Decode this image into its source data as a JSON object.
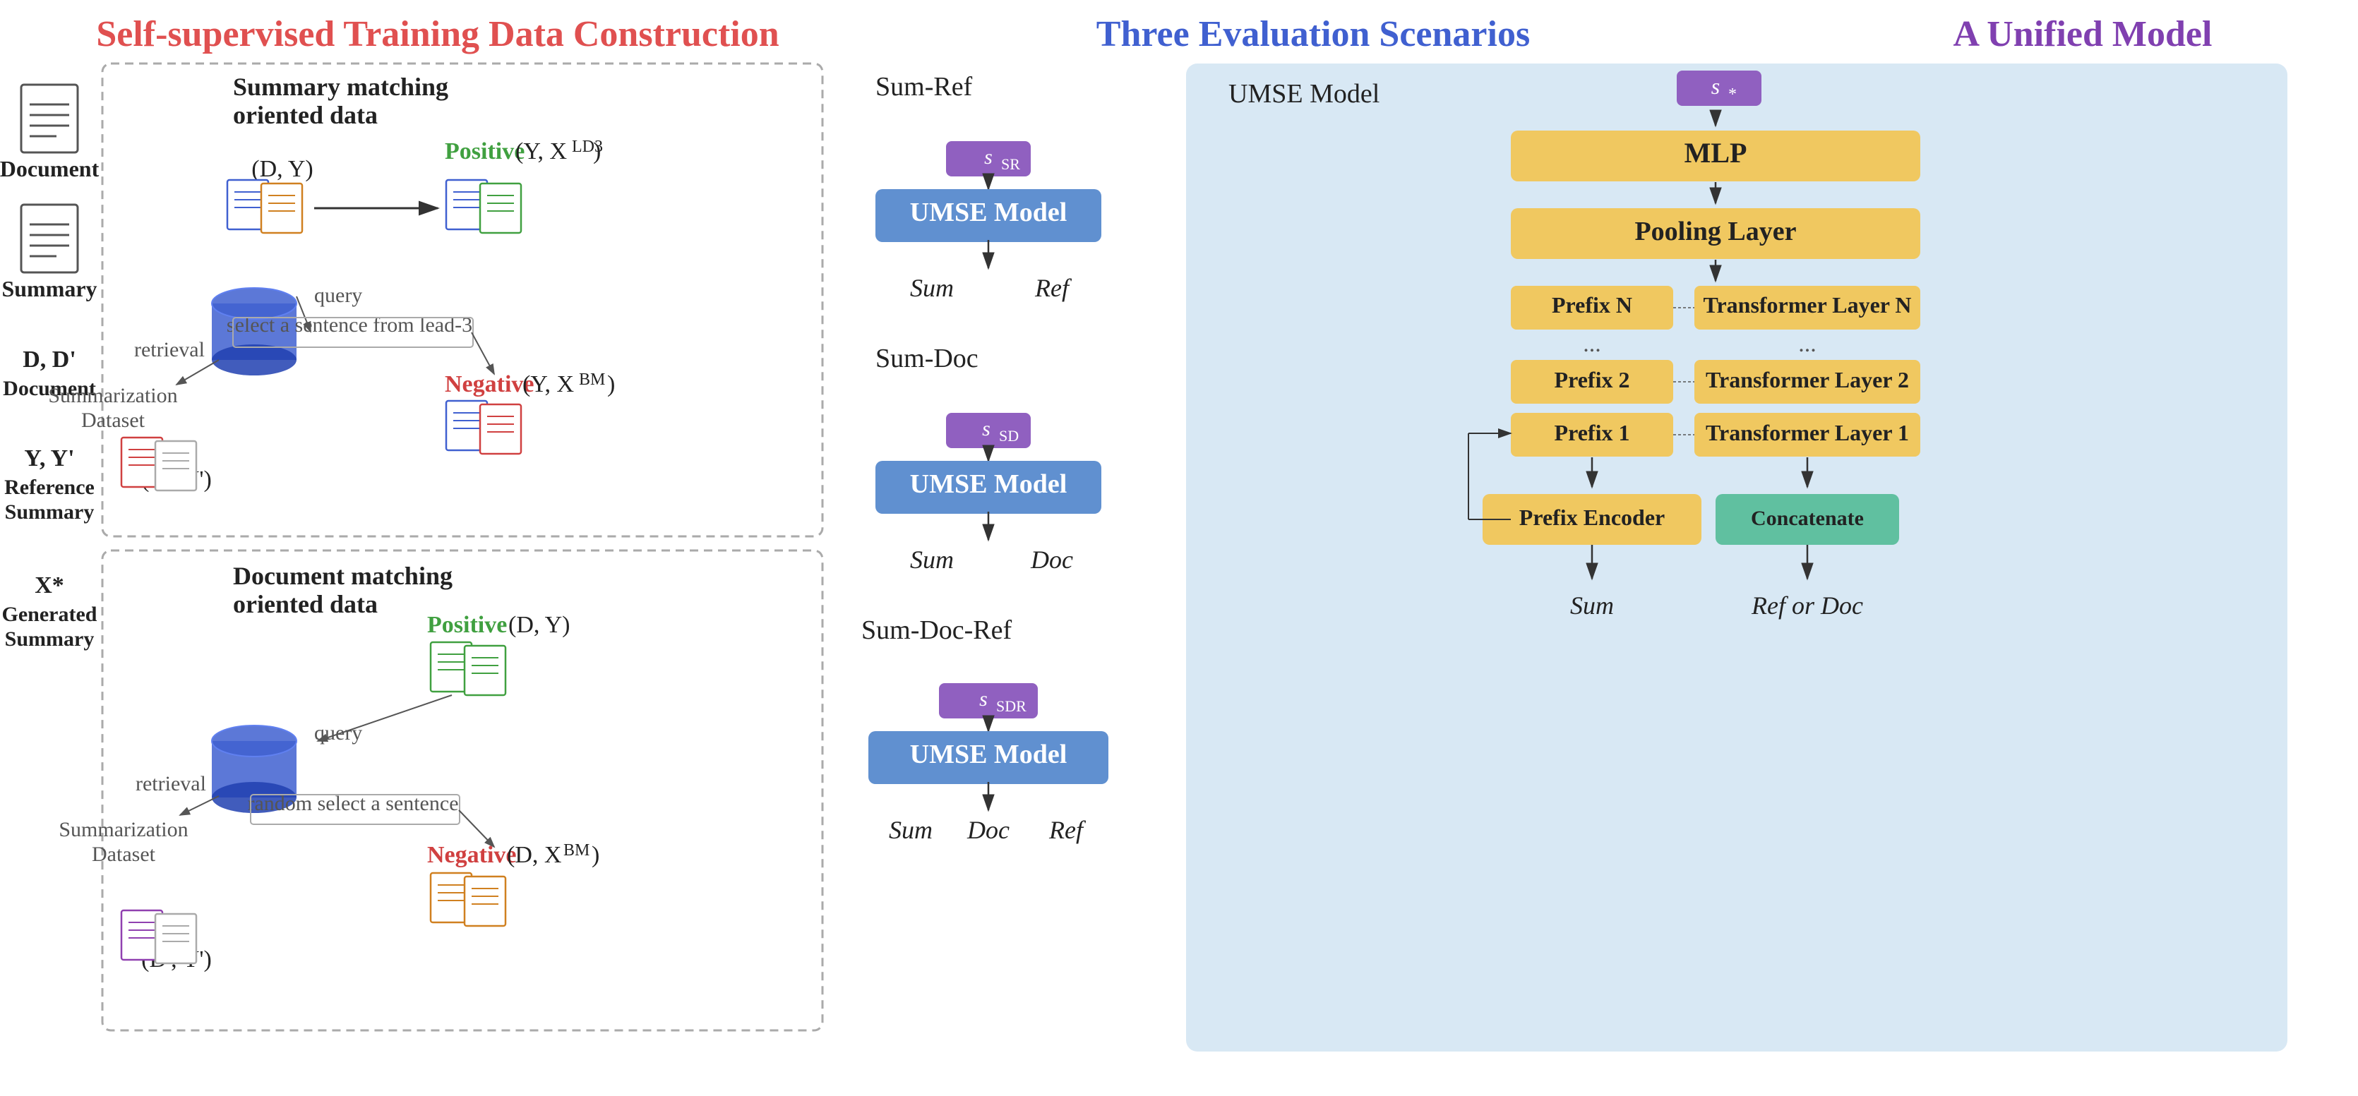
{
  "titles": {
    "left": "Self-supervised Training Data Construction",
    "middle": "Three Evaluation Scenarios",
    "right": "A Unified Model"
  },
  "legend": {
    "items": [
      {
        "main": "Document",
        "sub": ""
      },
      {
        "main": "Summary",
        "sub": ""
      },
      {
        "main": "D, D'",
        "sub": "Document"
      },
      {
        "main": "Y, Y'",
        "sub": "Reference\nSummary"
      },
      {
        "main": "X*",
        "sub": "Generated\nSummary"
      }
    ]
  },
  "upper_section": {
    "label": "Summary matching\noriented data",
    "pair_label": "(D, Y)",
    "positive_label": "Positive",
    "positive_pair": "(Y, X^{LD3})",
    "negative_label": "Negative",
    "negative_pair": "(Y, X^{BM})",
    "db_label": "Summarization\nDataset",
    "query_label": "query",
    "retrieval_label": "retrieval",
    "select_label": "select a sentence from lead-3",
    "bottom_pair": "(D', Y')"
  },
  "lower_section": {
    "label": "Document matching\noriented data",
    "positive_label": "Positive",
    "positive_pair": "(D, Y)",
    "negative_label": "Negative",
    "negative_pair": "(D, X^{BM})",
    "db_label": "Summarization\nDataset",
    "query_label": "query",
    "retrieval_label": "retrieval",
    "select_label": "random select a sentence",
    "bottom_pair": "(D', Y')"
  },
  "scenarios": [
    {
      "name": "Sum-Ref",
      "score": "s_SR",
      "model": "UMSE Model",
      "inputs": [
        "Sum",
        "Ref"
      ]
    },
    {
      "name": "Sum-Doc",
      "score": "s_SD",
      "model": "UMSE Model",
      "inputs": [
        "Sum",
        "Doc"
      ]
    },
    {
      "name": "Sum-Doc-Ref",
      "score": "s_SDR",
      "model": "UMSE Model",
      "inputs": [
        "Sum",
        "Doc",
        "Ref"
      ]
    }
  ],
  "unified_model": {
    "title": "UMSE Model",
    "output_score": "s_*",
    "layers": {
      "mlp": "MLP",
      "pooling": "Pooling Layer",
      "prefix_layers": [
        "Prefix N",
        "Prefix 2",
        "Prefix 1"
      ],
      "transformer_layers": [
        "Transformer Layer N",
        "Transformer Layer 2",
        "Transformer Layer 1"
      ],
      "prefix_dots": "...",
      "transformer_dots": "...",
      "prefix_encoder": "Prefix Encoder",
      "concatenate": "Concatenate"
    },
    "inputs": [
      "Sum",
      "Ref or Doc"
    ]
  },
  "colors": {
    "red_title": "#e05050",
    "blue_title": "#4060d0",
    "purple_title": "#8040b0",
    "umse_box": "#6090d0",
    "score_badge": "#9060c0",
    "model_layer": "#f0c860",
    "model_bg": "#d0e4f4",
    "concatenate": "#60b89a",
    "positive": "#40a040",
    "negative": "#d04040",
    "arrow": "#333333"
  }
}
